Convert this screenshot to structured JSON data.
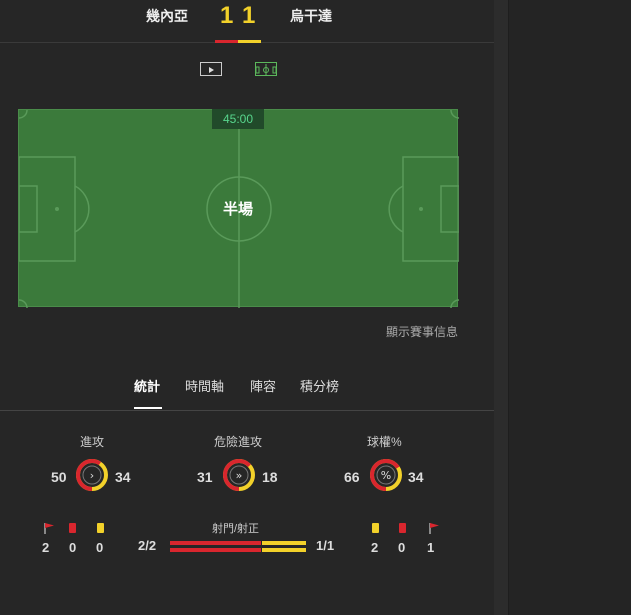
{
  "match": {
    "home_team": "幾內亞",
    "away_team": "烏干達",
    "home_score": "1",
    "away_score": "1"
  },
  "icons": [
    "video-icon",
    "pitch-icon"
  ],
  "field": {
    "clock": "45:00",
    "status": "半場"
  },
  "show_event_info": "顯示賽事信息",
  "tabs": [
    "統計",
    "時間軸",
    "陣容",
    "積分榜"
  ],
  "stats": [
    {
      "title": "進攻",
      "home": "50",
      "away": "34",
      "home_frac": 0.595,
      "glyph": "›"
    },
    {
      "title": "危險進攻",
      "home": "31",
      "away": "18",
      "home_frac": 0.633,
      "glyph": "»"
    },
    {
      "title": "球權%",
      "home": "66",
      "away": "34",
      "home_frac": 0.66,
      "glyph": "%"
    }
  ],
  "events": {
    "home_corners": "2",
    "home_red": "0",
    "home_yellow": "0",
    "away_yellow": "2",
    "away_red": "0",
    "away_corners": "1"
  },
  "shots": {
    "title": "射門/射正",
    "home": "2/2",
    "away": "1/1",
    "home_frac": 0.67
  },
  "colors": {
    "home": "#d9262e",
    "away": "#f2d12a",
    "pitch": "#3b7a3b"
  }
}
